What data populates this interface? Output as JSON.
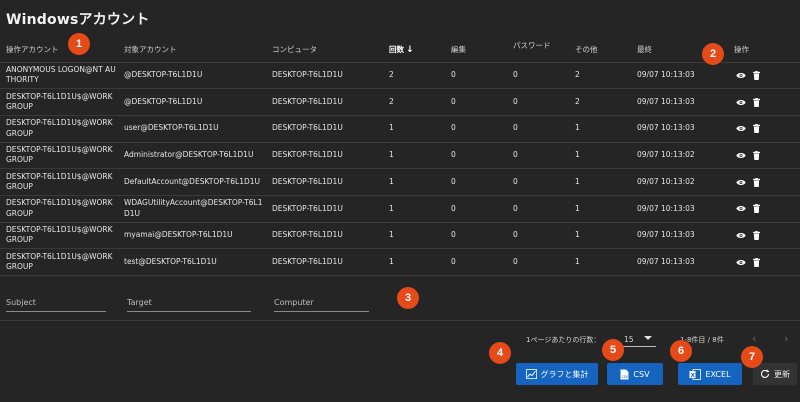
{
  "title": "Windowsアカウント",
  "columns": [
    "操作アカウント",
    "対象アカウント",
    "コンピュータ",
    "回数",
    "編集",
    "パスワード",
    "その他",
    "最終",
    "操作"
  ],
  "sort_arrow": "↓",
  "rows": [
    {
      "actor": "ANONYMOUS LOGON@NT AUTHORITY",
      "target": "@DESKTOP-T6L1D1U",
      "computer": "DESKTOP-T6L1D1U",
      "count": "2",
      "edit": "0",
      "password": "0",
      "other": "2",
      "last": "09/07 10:13:03"
    },
    {
      "actor": "DESKTOP-T6L1D1U$@WORKGROUP",
      "target": "@DESKTOP-T6L1D1U",
      "computer": "DESKTOP-T6L1D1U",
      "count": "2",
      "edit": "0",
      "password": "0",
      "other": "2",
      "last": "09/07 10:13:03"
    },
    {
      "actor": "DESKTOP-T6L1D1U$@WORKGROUP",
      "target": "user@DESKTOP-T6L1D1U",
      "computer": "DESKTOP-T6L1D1U",
      "count": "1",
      "edit": "0",
      "password": "0",
      "other": "1",
      "last": "09/07 10:13:03"
    },
    {
      "actor": "DESKTOP-T6L1D1U$@WORKGROUP",
      "target": "Administrator@DESKTOP-T6L1D1U",
      "computer": "DESKTOP-T6L1D1U",
      "count": "1",
      "edit": "0",
      "password": "0",
      "other": "1",
      "last": "09/07 10:13:02"
    },
    {
      "actor": "DESKTOP-T6L1D1U$@WORKGROUP",
      "target": "DefaultAccount@DESKTOP-T6L1D1U",
      "computer": "DESKTOP-T6L1D1U",
      "count": "1",
      "edit": "0",
      "password": "0",
      "other": "1",
      "last": "09/07 10:13:02"
    },
    {
      "actor": "DESKTOP-T6L1D1U$@WORKGROUP",
      "target": "WDAGUtilityAccount@DESKTOP-T6L1D1U",
      "computer": "DESKTOP-T6L1D1U",
      "count": "1",
      "edit": "0",
      "password": "0",
      "other": "1",
      "last": "09/07 10:13:03"
    },
    {
      "actor": "DESKTOP-T6L1D1U$@WORKGROUP",
      "target": "myamai@DESKTOP-T6L1D1U",
      "computer": "DESKTOP-T6L1D1U",
      "count": "1",
      "edit": "0",
      "password": "0",
      "other": "1",
      "last": "09/07 10:13:03"
    },
    {
      "actor": "DESKTOP-T6L1D1U$@WORKGROUP",
      "target": "test@DESKTOP-T6L1D1U",
      "computer": "DESKTOP-T6L1D1U",
      "count": "1",
      "edit": "0",
      "password": "0",
      "other": "1",
      "last": "09/07 10:13:03"
    }
  ],
  "row_actions": [
    "eye-icon",
    "trash-icon"
  ],
  "filters": {
    "subject_placeholder": "Subject",
    "target_placeholder": "Target",
    "computer_placeholder": "Computer"
  },
  "pager": {
    "rows_per_page_label": "1ページあたりの行数：",
    "rows_per_page_value": "15",
    "range_text": "1-8件目 / 8件"
  },
  "buttons": {
    "chart_label": "グラフと集計",
    "csv_label": "CSV",
    "excel_label": "EXCEL",
    "refresh_label": "更新"
  },
  "badges": [
    "1",
    "2",
    "3",
    "4",
    "5",
    "6",
    "7"
  ],
  "colors": {
    "badge": "#e64a19",
    "primary_button": "#1565c0",
    "background": "#252525"
  }
}
